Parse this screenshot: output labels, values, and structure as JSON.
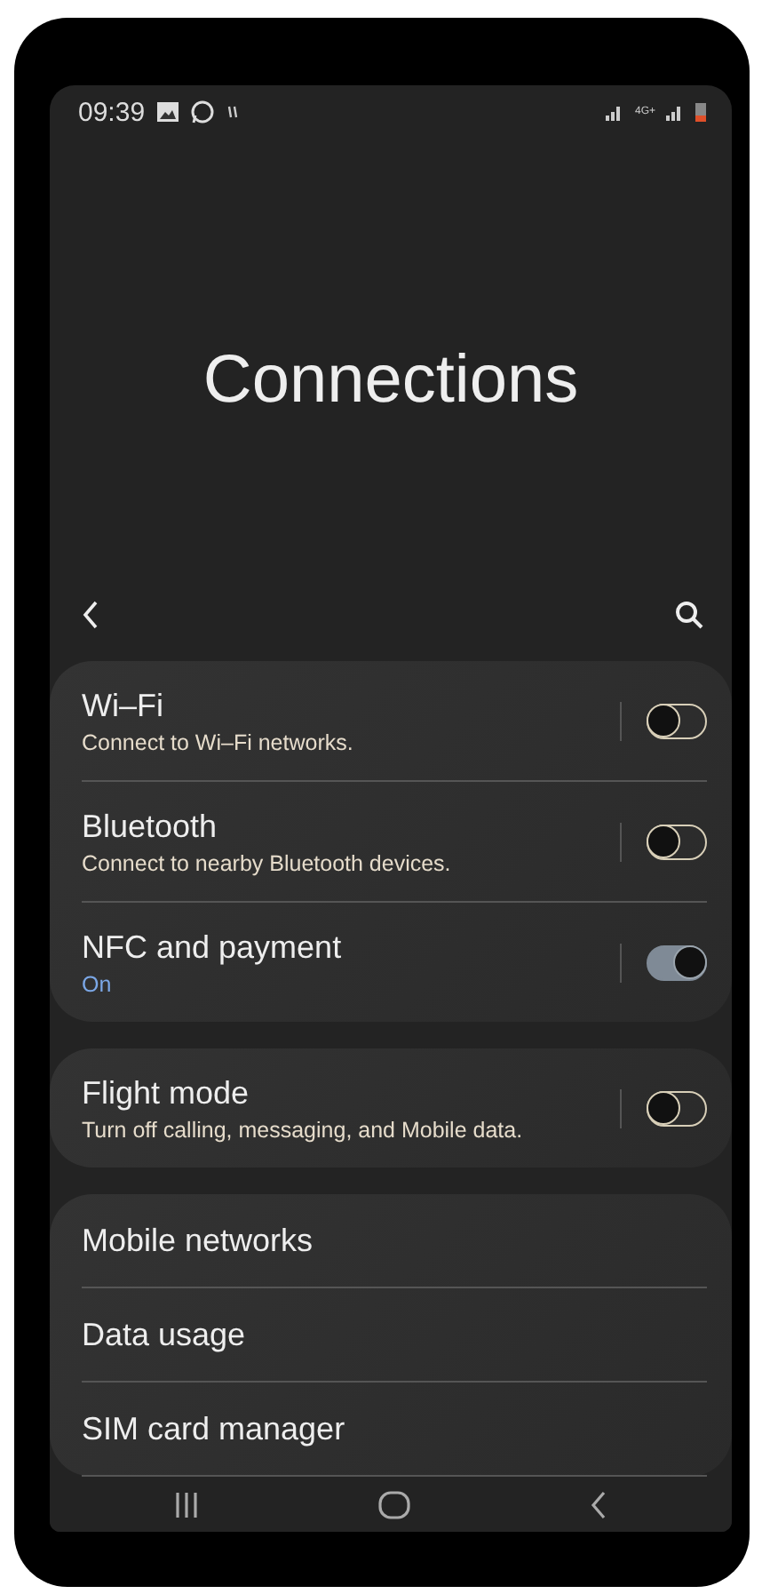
{
  "status_bar": {
    "time": "09:39",
    "network_type": "4G+"
  },
  "title": "Connections",
  "groups": [
    {
      "items": [
        {
          "kind": "switch",
          "title": "Wi–Fi",
          "subtitle": "Connect to Wi–Fi networks.",
          "highlight": false,
          "on": false
        },
        {
          "kind": "switch",
          "title": "Bluetooth",
          "subtitle": "Connect to nearby Bluetooth devices.",
          "highlight": false,
          "on": false
        },
        {
          "kind": "switch",
          "title": "NFC and payment",
          "subtitle": "On",
          "highlight": true,
          "on": true
        }
      ]
    },
    {
      "items": [
        {
          "kind": "switch",
          "title": "Flight mode",
          "subtitle": "Turn off calling, messaging, and Mobile data.",
          "highlight": false,
          "on": false
        }
      ]
    },
    {
      "items": [
        {
          "kind": "link",
          "title": "Mobile networks"
        },
        {
          "kind": "link",
          "title": "Data usage"
        },
        {
          "kind": "link",
          "title": "SIM card manager"
        }
      ]
    }
  ]
}
